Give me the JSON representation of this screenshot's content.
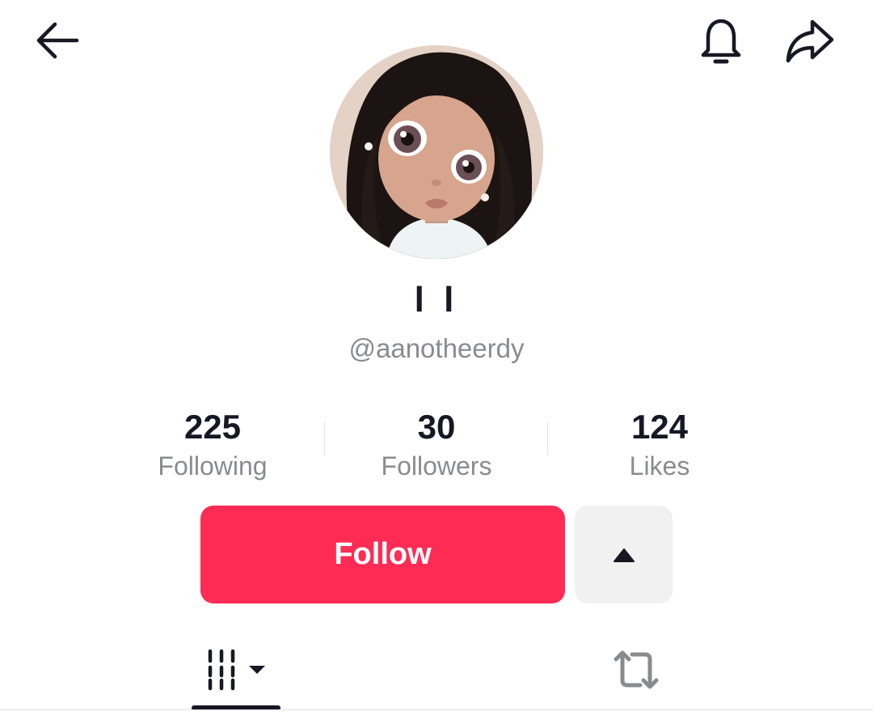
{
  "header": {
    "back_icon": "arrow-left-icon",
    "notification_icon": "bell-icon",
    "share_icon": "share-arrow-icon"
  },
  "profile": {
    "nickname": "l l",
    "username": "@aanotheerdy"
  },
  "stats": [
    {
      "value": "225",
      "label": "Following"
    },
    {
      "value": "30",
      "label": "Followers"
    },
    {
      "value": "124",
      "label": "Likes"
    }
  ],
  "actions": {
    "follow_label": "Follow",
    "more_icon": "caret-up-icon"
  },
  "tabs": {
    "videos_icon": "video-grid-icon",
    "reposts_icon": "repost-icon",
    "active": "videos"
  },
  "colors": {
    "follow_button": "#fe2c55",
    "secondary_text": "#8a8b91",
    "primary_text": "#161823"
  }
}
